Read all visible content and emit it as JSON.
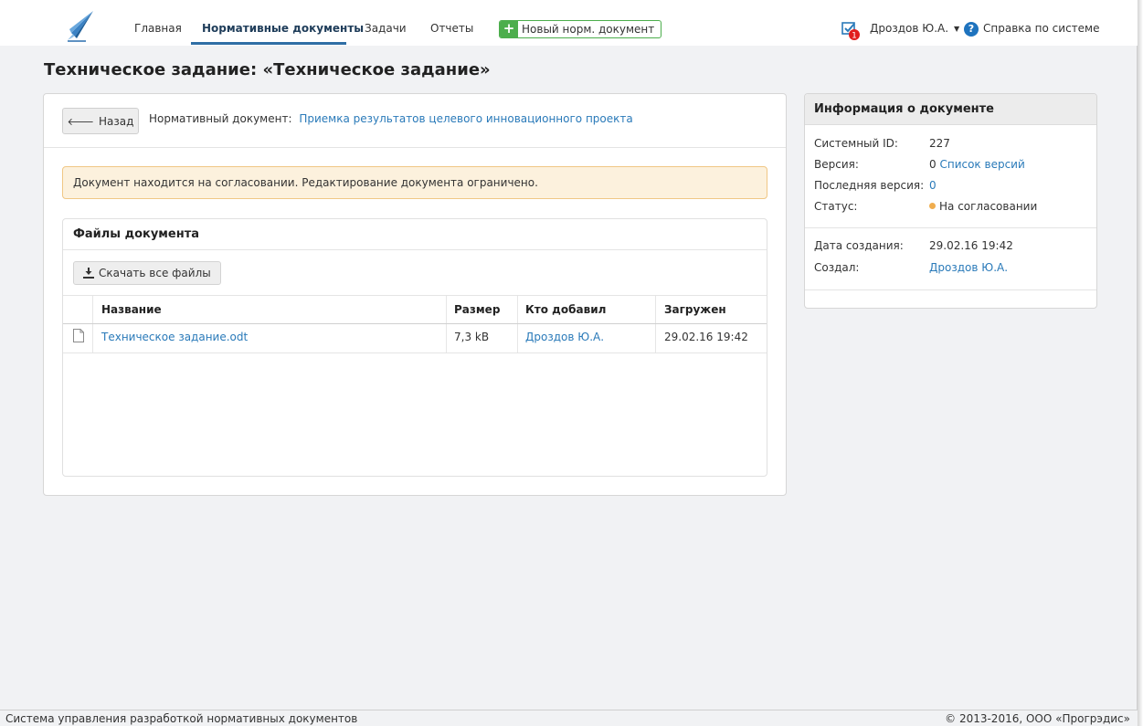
{
  "nav": {
    "items": [
      {
        "label": "Главная"
      },
      {
        "label": "Нормативные документы"
      },
      {
        "label": "Задачи"
      },
      {
        "label": "Отчеты"
      }
    ],
    "new_doc_label": "Новый норм. документ",
    "new_doc_icon": "plus-icon",
    "tasks_badge": "1",
    "user_name": "Дроздов Ю.А.",
    "help_label": "Справка по системе",
    "colors": {
      "active_underline": "#2f6ea5",
      "new_doc": "#4cae4c",
      "badge": "#e11d1d"
    }
  },
  "page": {
    "title": "Техническое задание: «Техническое задание»"
  },
  "main": {
    "back_label": "Назад",
    "doc_ref_label": "Нормативный документ:",
    "doc_ref_link": "Приемка результатов целевого инновационного проекта",
    "alert_text": "Документ находится на согласовании. Редактирование документа ограничено.",
    "files": {
      "title": "Файлы документа",
      "download_all_label": "Скачать все файлы",
      "columns": [
        "Название",
        "Размер",
        "Кто добавил",
        "Загружен"
      ],
      "rows": [
        {
          "name": "Техническое задание.odt",
          "size": "7,3 kB",
          "added_by": "Дроздов Ю.А.",
          "uploaded": "29.02.16 19:42"
        }
      ]
    }
  },
  "info": {
    "title": "Информация о документе",
    "system_id_label": "Системный ID:",
    "system_id": "227",
    "version_label": "Версия:",
    "version": "0",
    "versions_link": "Список версий",
    "last_version_label": "Последняя версия:",
    "last_version": "0",
    "status_label": "Статус:",
    "status": "На согласовании",
    "status_color": "#f0ad4e",
    "created_label": "Дата создания:",
    "created": "29.02.16 19:42",
    "author_label": "Создал:",
    "author": "Дроздов Ю.А."
  },
  "footer": {
    "left": "Система управления разработкой нормативных документов",
    "right": "© 2013-2016, ООО «Прогрэдис»"
  }
}
